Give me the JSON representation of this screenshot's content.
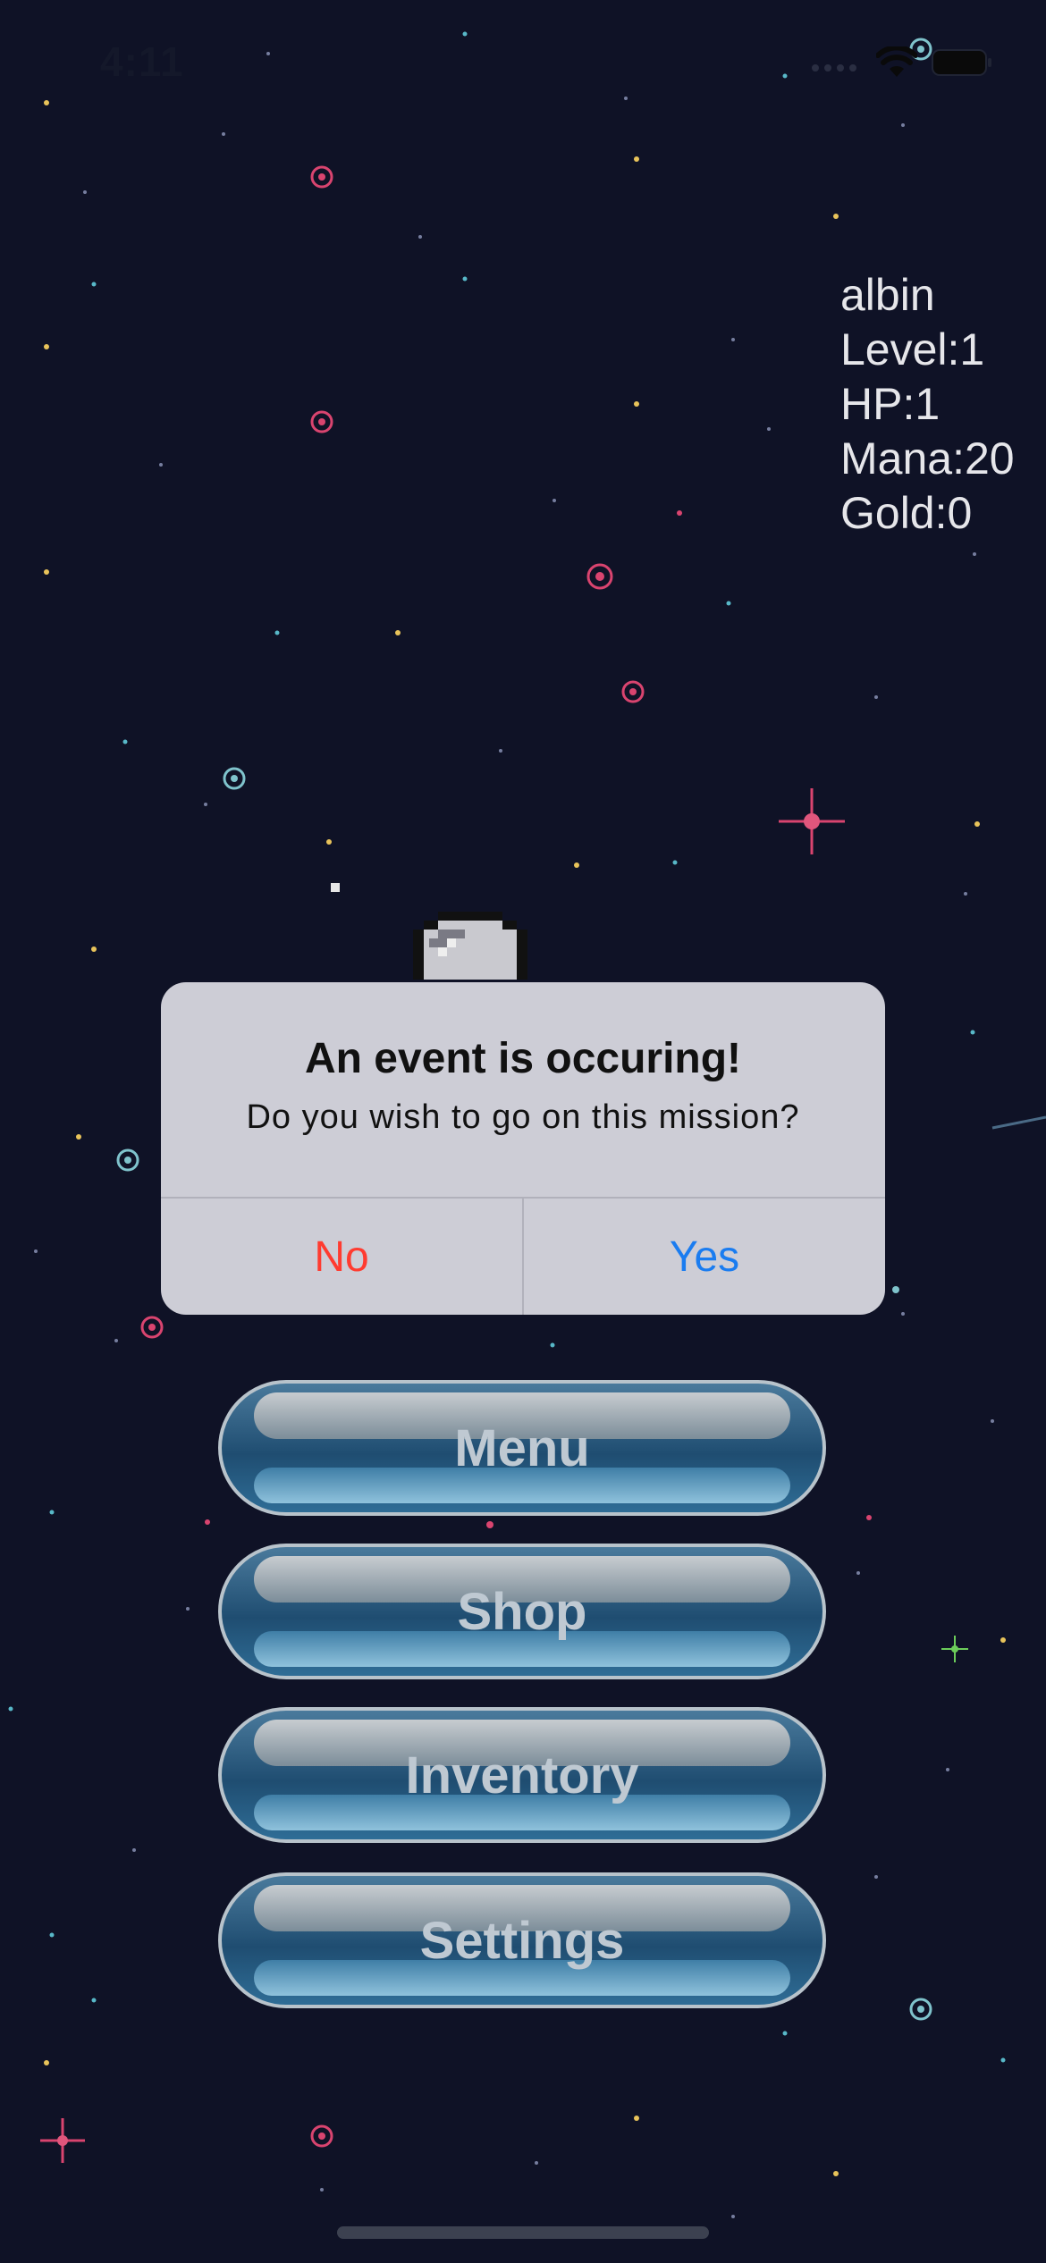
{
  "status_bar": {
    "time": "4:11"
  },
  "player_stats": {
    "name": "albin",
    "level": "Level:1",
    "hp": "HP:1",
    "mana": "Mana:20",
    "gold": "Gold:0"
  },
  "alert": {
    "title": "An event is occuring!",
    "message": "Do you wish to go on this mission?",
    "no_label": "No",
    "yes_label": "Yes"
  },
  "menu": {
    "items": [
      {
        "label": "Menu"
      },
      {
        "label": "Shop"
      },
      {
        "label": "Inventory"
      },
      {
        "label": "Settings"
      }
    ]
  },
  "colors": {
    "background": "#0f1226",
    "alert_no": "#ff3b30",
    "alert_yes": "#1a7cf0",
    "button_face": "#1f4d71"
  }
}
